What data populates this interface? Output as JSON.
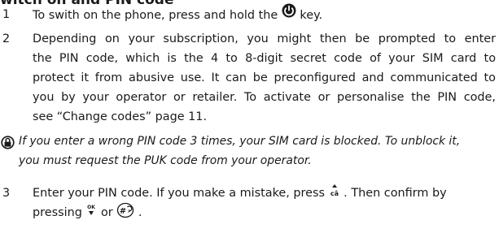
{
  "section": {
    "title": "witch on and PIN code"
  },
  "steps": [
    {
      "number": "1",
      "lines": [
        "To swith on the phone, press and hold the",
        "key."
      ],
      "key_icon": "power-key-icon"
    },
    {
      "number": "2",
      "lines": [
        "Depending on your subscription, you might then be prompted to enter",
        "the PIN code, which is the 4 to 8-digit secret code of your SIM card to",
        "protect it from abusive use. It can be preconfigured and communicated to",
        "you by your operator or retailer. To activate or personalise the PIN code,",
        "see “Change codes” page 11."
      ]
    },
    {
      "number": "3",
      "lines": [
        "Enter your PIN code. If you make a mistake, press",
        ". Then confirm by",
        "pressing",
        "or",
        "."
      ],
      "key_icons": [
        "clear-key-icon",
        "ok-key-icon",
        "hash-key-icon"
      ],
      "clear_key_label": "câ",
      "ok_key_label": "OK",
      "hash_key_label": "#"
    }
  ],
  "note": {
    "icon": "warning-icon",
    "lines": [
      "If you enter a wrong PIN code 3 times, your SIM card is blocked. To unblock it,",
      "you must request the PUK code from your operator."
    ]
  }
}
